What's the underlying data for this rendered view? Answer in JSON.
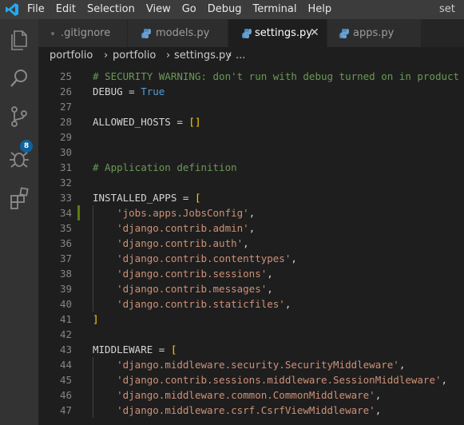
{
  "menu": [
    "File",
    "Edit",
    "Selection",
    "View",
    "Go",
    "Debug",
    "Terminal",
    "Help"
  ],
  "window_title": "set",
  "activity": {
    "scm_badge": "8"
  },
  "tabs": [
    {
      "label": ".gitignore",
      "active": false
    },
    {
      "label": "models.py",
      "active": false
    },
    {
      "label": "settings.py",
      "active": true
    },
    {
      "label": "apps.py",
      "active": false
    }
  ],
  "breadcrumb": {
    "seg1": "portfolio",
    "seg2": "portfolio",
    "seg3": "settings.py",
    "seg4": "..."
  },
  "editor": {
    "lines": [
      {
        "n": "25",
        "parts": [
          {
            "t": "# SECURITY WARNING: don't run with debug turned on in product",
            "c": "comment"
          }
        ]
      },
      {
        "n": "26",
        "parts": [
          {
            "t": "DEBUG = "
          },
          {
            "t": "True",
            "c": "bool"
          }
        ]
      },
      {
        "n": "27",
        "parts": []
      },
      {
        "n": "28",
        "parts": [
          {
            "t": "ALLOWED_HOSTS = "
          },
          {
            "t": "[]",
            "c": "bracket"
          }
        ]
      },
      {
        "n": "29",
        "parts": []
      },
      {
        "n": "30",
        "parts": []
      },
      {
        "n": "31",
        "parts": [
          {
            "t": "# Application definition",
            "c": "comment"
          }
        ]
      },
      {
        "n": "32",
        "parts": []
      },
      {
        "n": "33",
        "parts": [
          {
            "t": "INSTALLED_APPS = "
          },
          {
            "t": "[",
            "c": "bracket"
          }
        ]
      },
      {
        "n": "34",
        "parts": [
          {
            "t": "    "
          },
          {
            "t": "'jobs.apps.JobsConfig'",
            "c": "str"
          },
          {
            "t": ","
          }
        ],
        "modified": true,
        "indent": true
      },
      {
        "n": "35",
        "parts": [
          {
            "t": "    "
          },
          {
            "t": "'django.contrib.admin'",
            "c": "str"
          },
          {
            "t": ","
          }
        ],
        "indent": true
      },
      {
        "n": "36",
        "parts": [
          {
            "t": "    "
          },
          {
            "t": "'django.contrib.auth'",
            "c": "str"
          },
          {
            "t": ","
          }
        ],
        "indent": true
      },
      {
        "n": "37",
        "parts": [
          {
            "t": "    "
          },
          {
            "t": "'django.contrib.contenttypes'",
            "c": "str"
          },
          {
            "t": ","
          }
        ],
        "indent": true
      },
      {
        "n": "38",
        "parts": [
          {
            "t": "    "
          },
          {
            "t": "'django.contrib.sessions'",
            "c": "str"
          },
          {
            "t": ","
          }
        ],
        "indent": true
      },
      {
        "n": "39",
        "parts": [
          {
            "t": "    "
          },
          {
            "t": "'django.contrib.messages'",
            "c": "str"
          },
          {
            "t": ","
          }
        ],
        "indent": true
      },
      {
        "n": "40",
        "parts": [
          {
            "t": "    "
          },
          {
            "t": "'django.contrib.staticfiles'",
            "c": "str"
          },
          {
            "t": ","
          }
        ],
        "indent": true
      },
      {
        "n": "41",
        "parts": [
          {
            "t": "]",
            "c": "bracket"
          }
        ]
      },
      {
        "n": "42",
        "parts": []
      },
      {
        "n": "43",
        "parts": [
          {
            "t": "MIDDLEWARE = "
          },
          {
            "t": "[",
            "c": "bracket"
          }
        ]
      },
      {
        "n": "44",
        "parts": [
          {
            "t": "    "
          },
          {
            "t": "'django.middleware.security.SecurityMiddleware'",
            "c": "str"
          },
          {
            "t": ","
          }
        ],
        "indent": true
      },
      {
        "n": "45",
        "parts": [
          {
            "t": "    "
          },
          {
            "t": "'django.contrib.sessions.middleware.SessionMiddleware'",
            "c": "str"
          },
          {
            "t": ","
          }
        ],
        "indent": true
      },
      {
        "n": "46",
        "parts": [
          {
            "t": "    "
          },
          {
            "t": "'django.middleware.common.CommonMiddleware'",
            "c": "str"
          },
          {
            "t": ","
          }
        ],
        "indent": true
      },
      {
        "n": "47",
        "parts": [
          {
            "t": "    "
          },
          {
            "t": "'django.middleware.csrf.CsrfViewMiddleware'",
            "c": "str"
          },
          {
            "t": ","
          }
        ],
        "indent": true
      }
    ]
  },
  "colors": {
    "comment": "#6a9955",
    "bool": "#569cd6",
    "string": "#ce9178",
    "bracket": "#ffd700",
    "accent": "#0e639c"
  },
  "icons": [
    "vscode-logo-icon",
    "explorer-icon",
    "search-icon",
    "source-control-icon",
    "debug-icon",
    "extensions-icon",
    "close-icon",
    "python-file-icon",
    "gitignore-file-icon"
  ]
}
